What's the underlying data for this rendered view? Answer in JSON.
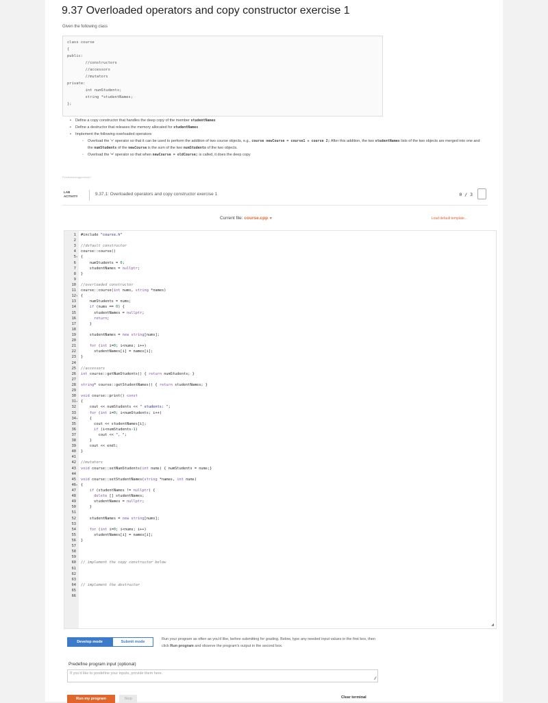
{
  "title": "9.37 Overloaded operators and copy constructor exercise 1",
  "intro": "Given the following class",
  "class_code": "class course\n{\npublic:\n        //constructors\n        //accessors\n        //mutators\nprivate:\n        int numStudents;\n        string *studentNames;\n};",
  "bullets": {
    "b1_text": "Define a copy constructor that handles the deep copy of the member ",
    "b1_code": "studentNames",
    "b2_text": "Define a destructor that releases the memory allocated for ",
    "b2_code": "studentNames",
    "b3_text": "Implement the following overloaded operators",
    "s1_a": "Overload the '+' operator so that it can be used to perform the addition of two course objects, e.g., ",
    "s1_code1": "course newCourse = course1 + course 2;",
    "s1_b": " After this addition, the two ",
    "s1_code2": "studentNames",
    "s1_c": " lists of the two objects are merged into one and the ",
    "s1_code3": "numStudents",
    "s1_d": " of the ",
    "s1_code4": "newCourse",
    "s1_e": " is the sum of the two ",
    "s1_code5": "numStudents",
    "s1_f": " of the two objects.",
    "s2_a": "Overload the '=' operator so that when ",
    "s2_code": "newCourse = oldCourse;",
    "s2_b": " is called, it does the deep copy"
  },
  "feedback": "Feedback/suggestions?",
  "lab": {
    "badge_line1": "LAB",
    "badge_line2": "ACTIVITY",
    "title": "9.37.1: Overloaded operators and copy constructor exercise 1",
    "score": "0 / 3"
  },
  "file_bar": {
    "label": "Current file: ",
    "filename": "course.cpp",
    "caret": "▼",
    "load_template": "Load default template..."
  },
  "buttons": {
    "develop": "Develop mode",
    "submit": "Submit mode",
    "run": "Run my program",
    "stop": "Stop",
    "clear": "Clear terminal"
  },
  "run_description_a": "Run your program as often as you'd like, before submitting for grading. Below, type any needed input values in the first box, then click ",
  "run_description_bold": "Run program",
  "run_description_b": " and observe the program's output in the second box.",
  "predefine": {
    "label": "Predefine program input (optional)",
    "placeholder": "If you'd like to predefine your inputs, provide them here."
  },
  "code_lines": [
    "#include \"course.h\"",
    "",
    "//default constructor",
    "course::course()",
    "{",
    "    numStudents = 0;",
    "    studentNames = nullptr;",
    "}",
    "",
    "//overloaded constructor",
    "course::course(int nums, string *names)",
    "{",
    "    numStudents = nums;",
    "    if (nums == 0) {",
    "      studentNames = nullptr;",
    "      return;",
    "    }",
    "",
    "    studentNames = new string[nums];",
    "",
    "    for (int i=0; i<nums; i++)",
    "      studentNames[i] = names[i];",
    "}",
    "",
    "//accessors",
    "int course::getNumStudents() { return numStudents; }",
    "",
    "string* course::getStudentNames() { return studentNames; }",
    "",
    "void course::print() const",
    "{",
    "    cout << numStudents << \" students: \";",
    "    for (int i=0; i<numStudents; i++)",
    "    {",
    "      cout << studentNames[i];",
    "      if (i<numStudents-1)",
    "        cout << \", \";",
    "    }",
    "    cout << endl;",
    "}",
    "",
    "//mutators",
    "void course::setNumStudents(int nums) { numStudents = nums;}",
    "",
    "void course::setStudentNames(string *names, int nums)",
    "{",
    "    if (studentNames != nullptr) {",
    "      delete [] studentNames;",
    "      studentNames = nullptr;",
    "    }",
    "",
    "    studentNames = new string[nums];",
    "",
    "    for (int i=0; i<nums; i++)",
    "      studentNames[i] = names[i];",
    "}",
    "",
    "",
    "",
    "// implement the copy constructor below",
    "",
    "",
    "",
    "// implement the destructor",
    "",
    ""
  ]
}
